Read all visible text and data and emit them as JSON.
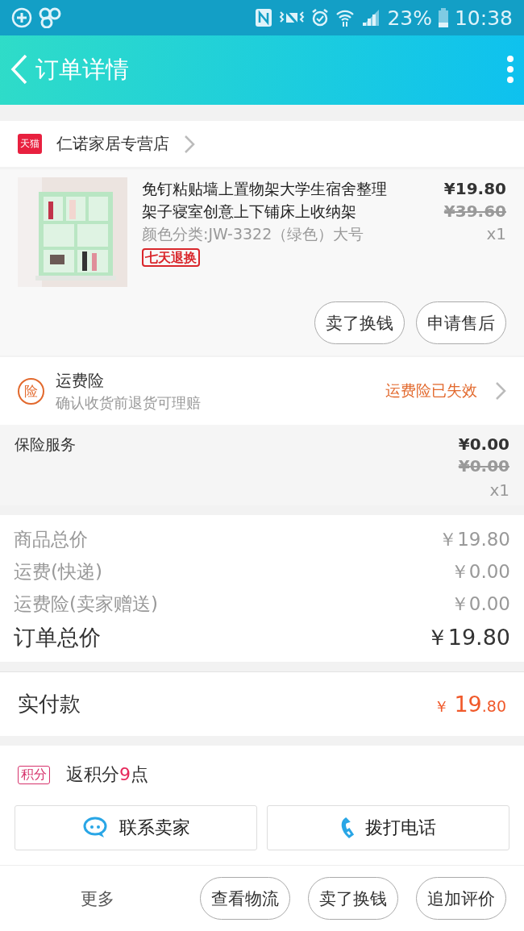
{
  "status_bar": {
    "battery": "23%",
    "time": "10:38"
  },
  "header": {
    "title": "订单详情"
  },
  "shop": {
    "badge": "天猫",
    "name": "仁诺家居专营店"
  },
  "item": {
    "title": "免钉粘贴墙上置物架大学生宿舍整理架子寝室创意上下铺床上收纳架",
    "sku": "颜色分类:JW-3322（绿色）大号",
    "tag": "七天退换",
    "price": "¥19.80",
    "original_price": "¥39.60",
    "quantity": "x1",
    "buttons": [
      "卖了换钱",
      "申请售后"
    ]
  },
  "shipping_insurance": {
    "icon_text": "险",
    "title": "运费险",
    "subtitle": "确认收货前退货可理赔",
    "status": "运费险已失效"
  },
  "insurance_service": {
    "title": "保险服务",
    "price": "¥0.00",
    "original_price": "¥0.00",
    "quantity": "x1"
  },
  "totals": [
    {
      "label": "商品总价",
      "value": "￥19.80",
      "kind": "line"
    },
    {
      "label": "运费(快递)",
      "value": "￥0.00",
      "kind": "line"
    },
    {
      "label": "运费险(卖家赠送)",
      "value": "￥0.00",
      "kind": "line"
    },
    {
      "label": "订单总价",
      "value": "￥19.80",
      "kind": "total"
    }
  ],
  "paid": {
    "label": "实付款",
    "currency": "￥",
    "integer": "19",
    "decimal": ".80"
  },
  "points": {
    "badge": "积分",
    "prefix": "返积分",
    "amount": "9",
    "suffix": "点"
  },
  "contacts": [
    {
      "label": "联系卖家",
      "kind": "chat"
    },
    {
      "label": "拨打电话",
      "kind": "phone"
    }
  ],
  "actions": {
    "more": "更多",
    "buttons": [
      "查看物流",
      "卖了换钱",
      "追加评价"
    ]
  }
}
